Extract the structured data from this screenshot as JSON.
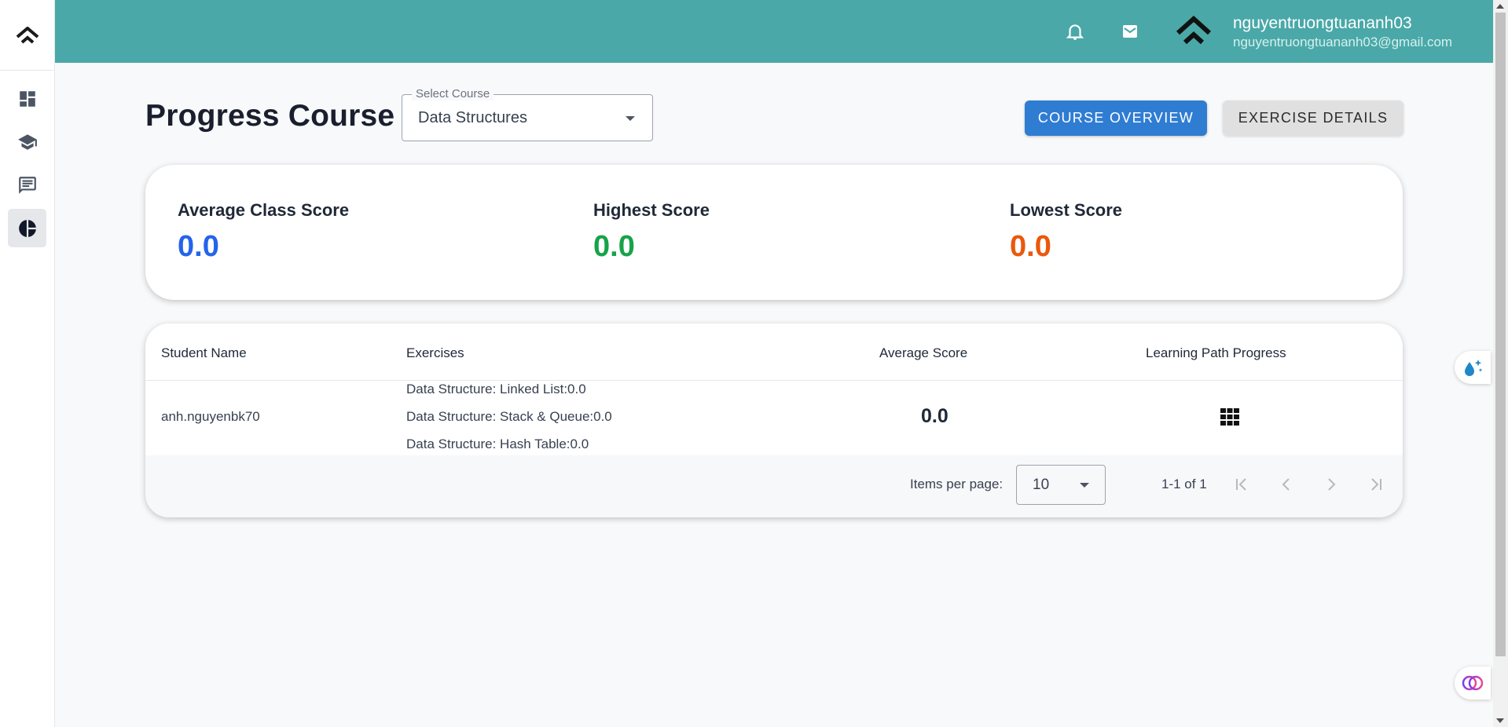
{
  "header": {
    "user_name": "nguyentruongtuananh03",
    "user_email": "nguyentruongtuananh03@gmail.com"
  },
  "page": {
    "title": "Progress Course",
    "select_course_label": "Select Course",
    "select_course_value": "Data Structures",
    "course_overview_label": "COURSE OVERVIEW",
    "exercise_details_label": "EXERCISE DETAILS"
  },
  "stats": {
    "average_label": "Average Class Score",
    "average_value": "0.0",
    "average_color": "#2563eb",
    "highest_label": "Highest Score",
    "highest_value": "0.0",
    "highest_color": "#16a34a",
    "lowest_label": "Lowest Score",
    "lowest_value": "0.0",
    "lowest_color": "#ea580c"
  },
  "table": {
    "headers": [
      "Student Name",
      "Exercises",
      "Average Score",
      "Learning Path Progress"
    ],
    "rows": [
      {
        "student": "anh.nguyenbk70",
        "exercises": [
          "Data Structure: Linked List:0.0",
          "Data Structure: Stack & Queue:0.0",
          "Data Structure: Hash Table:0.0"
        ],
        "average": "0.0",
        "progress_icon": "grid-icon"
      }
    ],
    "items_per_page_label": "Items per page:",
    "items_per_page_value": "10",
    "range_label": "1-1 of 1"
  },
  "colors": {
    "header_bg": "#4aa8a8",
    "primary_button": "#2f7dd3"
  }
}
